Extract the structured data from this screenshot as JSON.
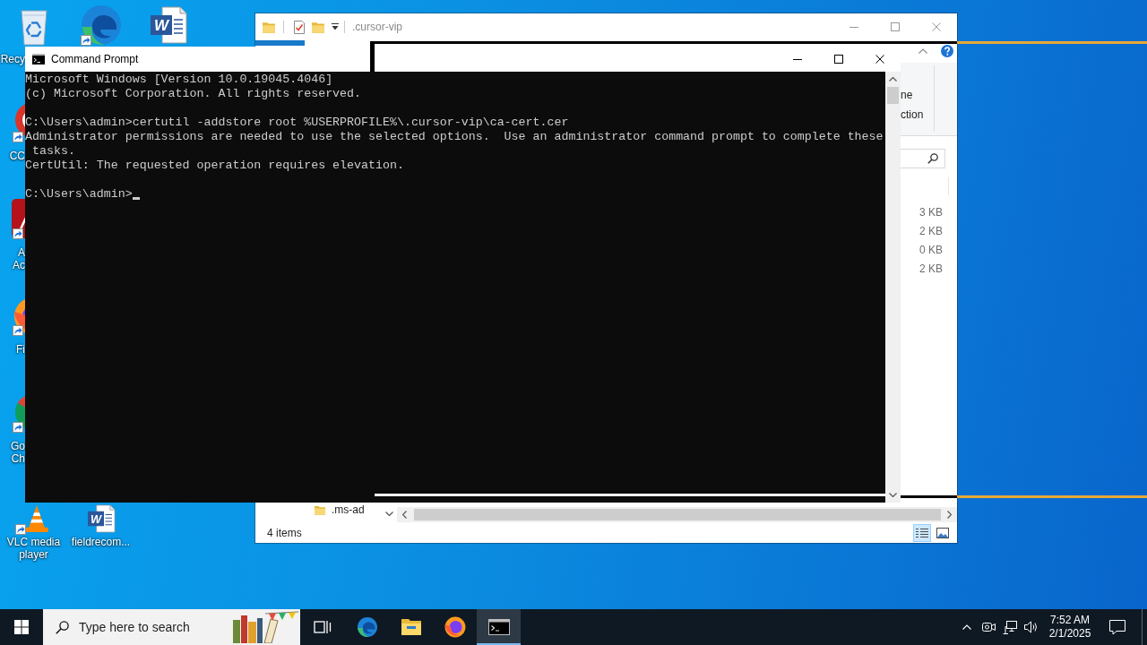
{
  "desktop_icons": [
    {
      "kind": "recycle-bin",
      "shortcut": false,
      "label_lines": [
        "Recy"
      ]
    },
    {
      "kind": "edge",
      "shortcut": true
    },
    {
      "kind": "word-document",
      "shortcut": false,
      "letter": "W"
    },
    {
      "kind": "ccleaner",
      "shortcut": true,
      "label_lines": [
        "CC"
      ]
    },
    {
      "kind": "acrobat",
      "shortcut": true,
      "label_lines": [
        "A",
        "Ac"
      ]
    },
    {
      "kind": "firefox",
      "shortcut": true,
      "label_lines": [
        "Fi"
      ]
    },
    {
      "kind": "chrome",
      "shortcut": true,
      "label_lines": [
        "Go",
        "Ch"
      ]
    },
    {
      "kind": "vlc",
      "shortcut": true,
      "label_lines": [
        "VLC media",
        "player"
      ]
    },
    {
      "kind": "word-document",
      "shortcut": false,
      "letter": "W",
      "label_lines": [
        "fieldrecom..."
      ]
    }
  ],
  "explorer": {
    "title": ".cursor-vip",
    "ribbon_labels": [
      "ne",
      "ction"
    ],
    "file_rows": [
      {
        "column_4": "3 KB"
      },
      {
        "column_4": "2 KB"
      },
      {
        "column_4": "0 KB"
      },
      {
        "column_4": "2 KB"
      }
    ],
    "navigation_items": [
      {
        "label": ".ms-ad"
      }
    ],
    "status_bar": {
      "item_count": "4 items"
    },
    "view_buttons": [
      {
        "kind": "details",
        "selected": true
      },
      {
        "kind": "large-icons",
        "selected": false
      }
    ]
  },
  "command_prompt": {
    "title": "Command Prompt",
    "output_blocks": [
      [
        "Microsoft Windows [Version 10.0.19045.4046]",
        "(c) Microsoft Corporation. All rights reserved."
      ],
      [
        "C:\\Users\\admin>certutil -addstore root %USERPROFILE%\\.cursor-vip\\ca-cert.cer",
        "Administrator permissions are needed to use the selected options.  Use an administrator command prompt to complete these tasks.",
        "CertUtil: The requested operation requires elevation."
      ],
      [
        "C:\\Users\\admin>"
      ]
    ],
    "cursor": true
  },
  "taskbar": {
    "search": {
      "placeholder": "Type here to search"
    },
    "buttons": [
      {
        "kind": "task-view",
        "selected": false
      },
      {
        "kind": "edge",
        "selected": false
      },
      {
        "kind": "file-explorer",
        "selected": false
      },
      {
        "kind": "firefox",
        "selected": false
      },
      {
        "kind": "command-prompt",
        "selected": true
      }
    ],
    "clock": {
      "time": "7:52 AM",
      "date": "2/1/2025"
    }
  }
}
